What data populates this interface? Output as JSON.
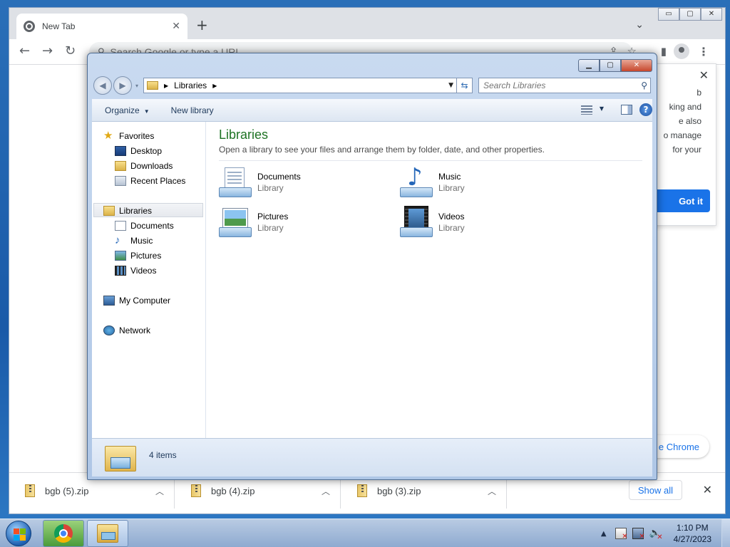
{
  "chrome": {
    "tab_title": "New Tab",
    "new_tab_symbol": "+",
    "omnibox_placeholder": "Search Google or type a URL",
    "window_controls": [
      "▭",
      "▢",
      "✕"
    ],
    "popup": {
      "text_lines": [
        "b",
        "king and",
        "e also",
        "o manage",
        "for your"
      ],
      "button": "Got it"
    },
    "customize_chip": "e Chrome"
  },
  "downloads": {
    "items": [
      {
        "name": "bgb (5).zip"
      },
      {
        "name": "bgb (4).zip"
      },
      {
        "name": "bgb (3).zip"
      }
    ],
    "show_all": "Show all"
  },
  "explorer": {
    "breadcrumb": [
      "Libraries"
    ],
    "search_placeholder": "Search Libraries",
    "command_bar": {
      "organize": "Organize",
      "new_library": "New library"
    },
    "nav": {
      "favorites_header": "Favorites",
      "favorites": [
        "Desktop",
        "Downloads",
        "Recent Places"
      ],
      "libraries_header": "Libraries",
      "libraries": [
        "Documents",
        "Music",
        "Pictures",
        "Videos"
      ],
      "computer": "My Computer",
      "network": "Network"
    },
    "heading": "Libraries",
    "subheading": "Open a library to see your files and arrange them by folder, date, and other properties.",
    "libraries": [
      {
        "name": "Documents",
        "type": "Library",
        "icon": "documents-library-icon"
      },
      {
        "name": "Music",
        "type": "Library",
        "icon": "music-library-icon"
      },
      {
        "name": "Pictures",
        "type": "Library",
        "icon": "pictures-library-icon"
      },
      {
        "name": "Videos",
        "type": "Library",
        "icon": "videos-library-icon"
      }
    ],
    "status": "4 items"
  },
  "taskbar": {
    "time": "1:10 PM",
    "date": "4/27/2023"
  },
  "colors": {
    "accent_blue": "#1a73e8",
    "library_heading_green": "#1e7324",
    "desktop_blue": "#1a5aa8"
  }
}
